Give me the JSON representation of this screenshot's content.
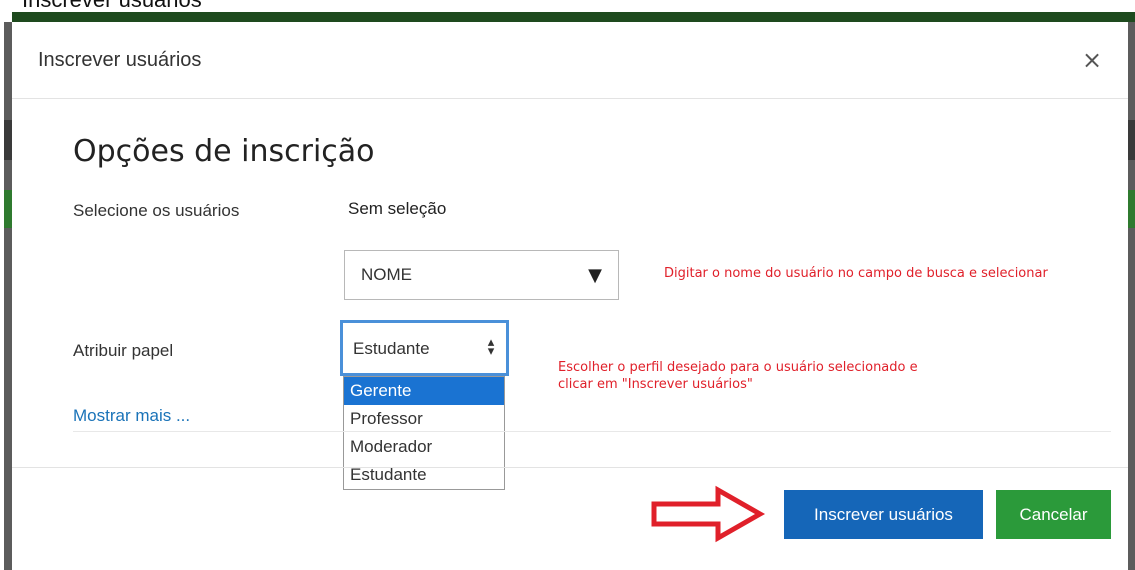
{
  "background": {
    "caption": "Inscrever usuários"
  },
  "modal": {
    "title": "Inscrever usuários",
    "close_label": "×",
    "section_title": "Opções de inscrição",
    "users_label": "Selecione os usuários",
    "users_selection": "Sem seleção",
    "name_search": {
      "value": "NOME",
      "caret": "▼"
    },
    "name_hint": "Digitar o nome do usuário no campo de busca e selecionar",
    "role_label": "Atribuir papel",
    "role_select": {
      "value": "Estudante",
      "arrows_icon": "up-down-arrows-icon"
    },
    "role_hint": "Escolher o perfil desejado para o usuário selecionado e clicar em \"Inscrever usuários\"",
    "role_options": [
      {
        "label": "Gerente",
        "highlighted": true
      },
      {
        "label": "Professor",
        "highlighted": false
      },
      {
        "label": "Moderador",
        "highlighted": false
      },
      {
        "label": "Estudante",
        "highlighted": false
      }
    ],
    "show_more": "Mostrar mais ...",
    "enroll_button": "Inscrever usuários",
    "cancel_button": "Cancelar"
  },
  "colors": {
    "primary": "#1566b8",
    "success": "#2b9a3a",
    "annotation_red": "#e0202a",
    "focus_blue": "#4a90d9",
    "header_green": "#1e4a1e"
  }
}
